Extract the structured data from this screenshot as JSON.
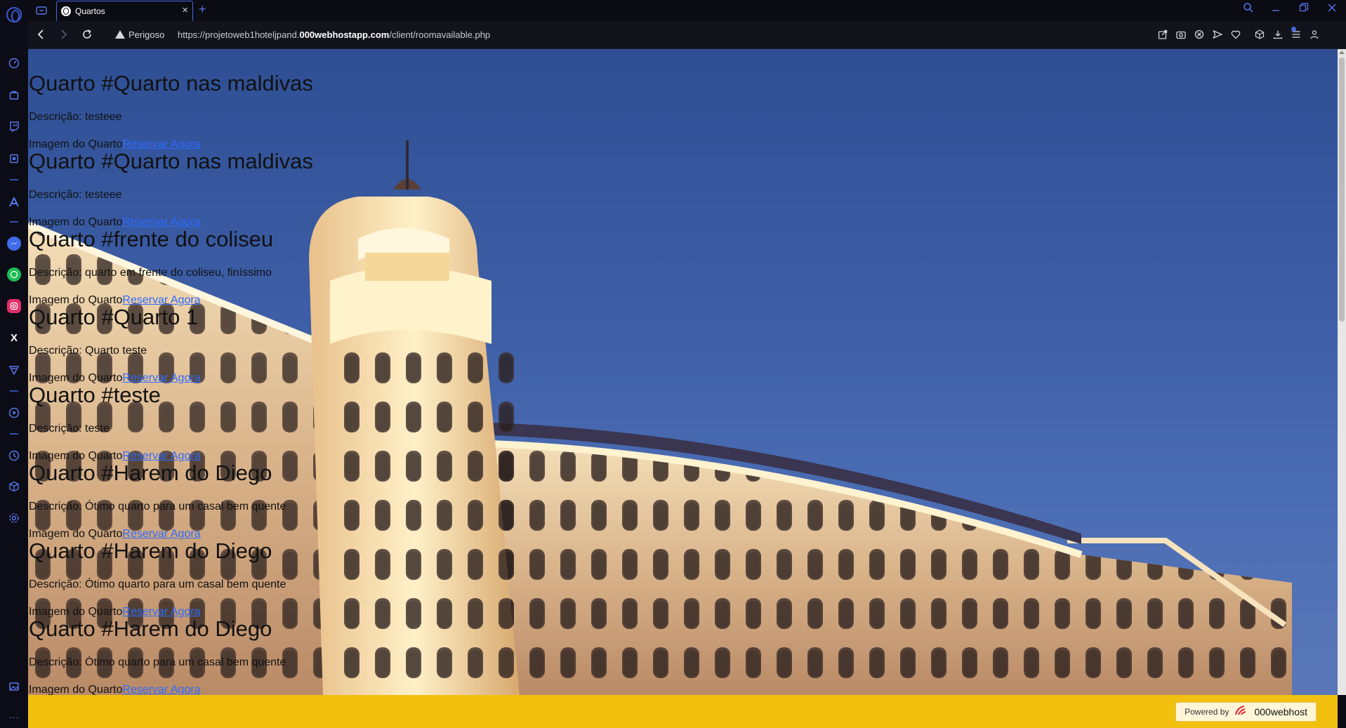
{
  "browser": {
    "tab_title": "Quartos",
    "close_tab": "×",
    "new_tab": "+",
    "security_label": "Perigoso",
    "url_prefix": "https://projetoweb1hoteljpand.",
    "url_domain": "000webhostapp.com",
    "url_path": "/client/roomavailable.php",
    "accent_color": "#4a66e0"
  },
  "sidebar": {
    "icons": [
      "speed-dial-icon",
      "bag-icon",
      "twitch-icon",
      "book-icon",
      "aria-icon",
      "messenger-icon",
      "whatsapp-icon",
      "instagram-icon",
      "x-icon",
      "vpn-icon",
      "player-icon",
      "history-icon",
      "extensions-icon",
      "settings-icon",
      "image-icon",
      "more-icon"
    ],
    "x_label": "X",
    "more_label": "···"
  },
  "page": {
    "rooms": [
      {
        "title": "Quarto #Quarto nas maldivas",
        "description": "Descrição: testeee",
        "image_alt": "Imagem do Quarto",
        "link": "Reservar Agora"
      },
      {
        "title": "Quarto #Quarto nas maldivas",
        "description": "Descrição: testeee",
        "image_alt": "Imagem do Quarto",
        "link": "Reservar Agora"
      },
      {
        "title": "Quarto #frente do coliseu",
        "description": "Descrição: quarto em frente do coliseu, finíssimo",
        "image_alt": "Imagem do Quarto",
        "link": "Reservar Agora"
      },
      {
        "title": "Quarto #Quarto 1",
        "description": "Descrição: Quarto teste",
        "image_alt": "Imagem do Quarto",
        "link": "Reservar Agora"
      },
      {
        "title": "Quarto #teste",
        "description": "Descrição: teste",
        "image_alt": "Imagem do Quarto",
        "link": "Reservar Agora"
      },
      {
        "title": "Quarto #Harem do Diego",
        "description": "Descrição: Ótimo quarto para um casal bem quente",
        "image_alt": "Imagem do Quarto",
        "link": "Reservar Agora"
      },
      {
        "title": "Quarto #Harem do Diego",
        "description": "Descrição: Ótimo quarto para um casal bem quente",
        "image_alt": "Imagem do Quarto",
        "link": "Reservar Agora"
      },
      {
        "title": "Quarto #Harem do Diego",
        "description": "Descrição: Ótimo quarto para um casal bem quente",
        "image_alt": "Imagem do Quarto",
        "link": "Reservar Agora"
      }
    ],
    "footer": {
      "powered_by": "Powered by",
      "brand": "000webhost",
      "background_color": "#f2c10f"
    }
  }
}
